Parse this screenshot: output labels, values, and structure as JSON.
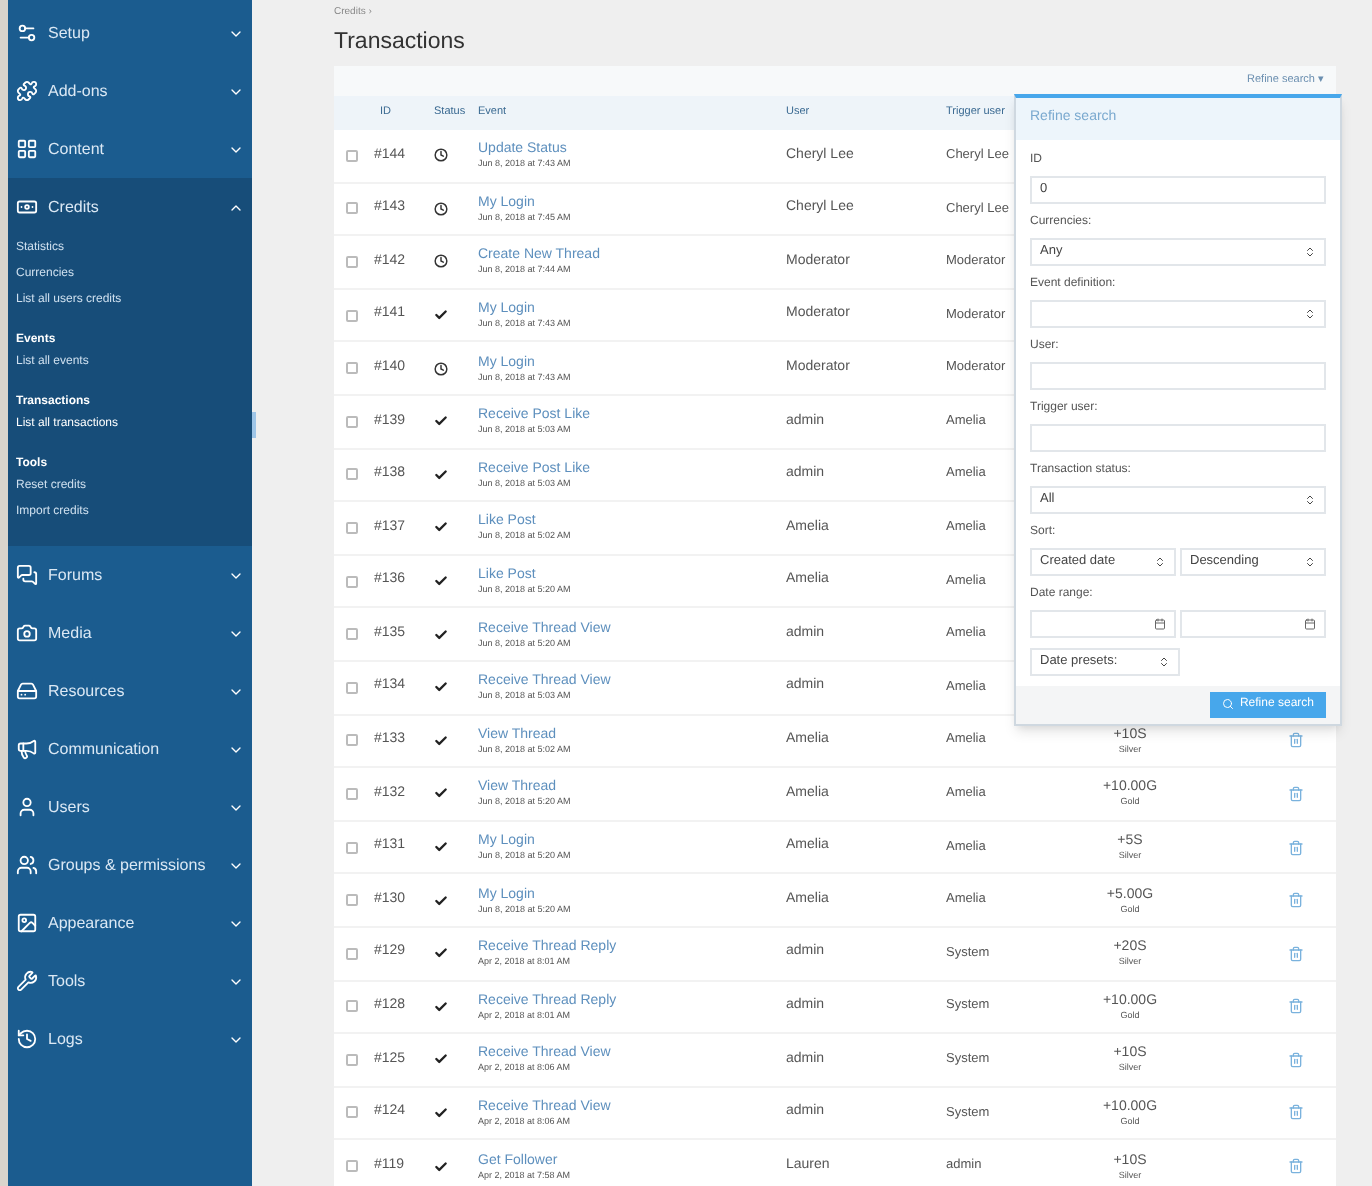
{
  "sidebar": {
    "items": [
      {
        "label": "Setup",
        "expanded": false
      },
      {
        "label": "Add-ons",
        "expanded": false
      },
      {
        "label": "Content",
        "expanded": false
      },
      {
        "label": "Credits",
        "expanded": true,
        "children": [
          {
            "kind": "link",
            "label": "Statistics",
            "selected": false
          },
          {
            "kind": "link",
            "label": "Currencies",
            "selected": false
          },
          {
            "kind": "link",
            "label": "List all users credits",
            "selected": false
          },
          {
            "kind": "heading",
            "label": "Events"
          },
          {
            "kind": "link",
            "label": "List all events",
            "selected": false
          },
          {
            "kind": "heading",
            "label": "Transactions"
          },
          {
            "kind": "link",
            "label": "List all transactions",
            "selected": true
          },
          {
            "kind": "heading",
            "label": "Tools"
          },
          {
            "kind": "link",
            "label": "Reset credits",
            "selected": false
          },
          {
            "kind": "link",
            "label": "Import credits",
            "selected": false
          }
        ]
      },
      {
        "label": "Forums",
        "expanded": false
      },
      {
        "label": "Media",
        "expanded": false
      },
      {
        "label": "Resources",
        "expanded": false
      },
      {
        "label": "Communication",
        "expanded": false
      },
      {
        "label": "Users",
        "expanded": false
      },
      {
        "label": "Groups & permissions",
        "expanded": false
      },
      {
        "label": "Appearance",
        "expanded": false
      },
      {
        "label": "Tools",
        "expanded": false
      },
      {
        "label": "Logs",
        "expanded": false
      }
    ]
  },
  "breadcrumb": "Credits ›",
  "title": "Transactions",
  "refine_toggle": "Refine search ▾",
  "table": {
    "columns": [
      "ID",
      "Status",
      "Event",
      "User",
      "Trigger user"
    ],
    "rows": [
      {
        "checked": false,
        "id": "#144",
        "kind": "pending",
        "event": "Update Status",
        "date": "Jun 8, 2018 at 7:43 AM",
        "user": "Cheryl Lee",
        "trigger": "Cheryl Lee"
      },
      {
        "checked": false,
        "id": "#143",
        "kind": "pending",
        "event": "My Login",
        "date": "Jun 8, 2018 at 7:45 AM",
        "user": "Cheryl Lee",
        "trigger": "Cheryl Lee"
      },
      {
        "checked": false,
        "id": "#142",
        "kind": "pending",
        "event": "Create New Thread",
        "date": "Jun 8, 2018 at 7:44 AM",
        "user": "Moderator",
        "trigger": "Moderator"
      },
      {
        "checked": false,
        "id": "#141",
        "kind": "completed",
        "event": "My Login",
        "date": "Jun 8, 2018 at 7:43 AM",
        "user": "Moderator",
        "trigger": "Moderator"
      },
      {
        "checked": false,
        "id": "#140",
        "kind": "pending",
        "event": "My Login",
        "date": "Jun 8, 2018 at 7:43 AM",
        "user": "Moderator",
        "trigger": "Moderator"
      },
      {
        "checked": false,
        "id": "#139",
        "kind": "completed",
        "event": "Receive Post Like",
        "date": "Jun 8, 2018 at 5:03 AM",
        "user": "admin",
        "trigger": "Amelia"
      },
      {
        "checked": false,
        "id": "#138",
        "kind": "completed",
        "event": "Receive Post Like",
        "date": "Jun 8, 2018 at 5:03 AM",
        "user": "admin",
        "trigger": "Amelia"
      },
      {
        "checked": false,
        "id": "#137",
        "kind": "completed",
        "event": "Like Post",
        "date": "Jun 8, 2018 at 5:02 AM",
        "user": "Amelia",
        "trigger": "Amelia"
      },
      {
        "checked": false,
        "id": "#136",
        "kind": "completed",
        "event": "Like Post",
        "date": "Jun 8, 2018 at 5:20 AM",
        "user": "Amelia",
        "trigger": "Amelia"
      },
      {
        "checked": false,
        "id": "#135",
        "kind": "completed",
        "event": "Receive Thread View",
        "date": "Jun 8, 2018 at 5:20 AM",
        "user": "admin",
        "trigger": "Amelia"
      },
      {
        "checked": false,
        "id": "#134",
        "kind": "completed",
        "event": "Receive Thread View",
        "date": "Jun 8, 2018 at 5:03 AM",
        "user": "admin",
        "trigger": "Amelia"
      },
      {
        "checked": false,
        "id": "#133",
        "kind": "completed",
        "event": "View Thread",
        "date": "Jun 8, 2018 at 5:02 AM",
        "user": "Amelia",
        "trigger": "Amelia",
        "amount": "+10S",
        "currency": "Silver"
      },
      {
        "checked": false,
        "id": "#132",
        "kind": "completed",
        "event": "View Thread",
        "date": "Jun 8, 2018 at 5:20 AM",
        "user": "Amelia",
        "trigger": "Amelia",
        "amount": "+10.00G",
        "currency": "Gold"
      },
      {
        "checked": false,
        "id": "#131",
        "kind": "completed",
        "event": "My Login",
        "date": "Jun 8, 2018 at 5:20 AM",
        "user": "Amelia",
        "trigger": "Amelia",
        "amount": "+5S",
        "currency": "Silver"
      },
      {
        "checked": false,
        "id": "#130",
        "kind": "completed",
        "event": "My Login",
        "date": "Jun 8, 2018 at 5:20 AM",
        "user": "Amelia",
        "trigger": "Amelia",
        "amount": "+5.00G",
        "currency": "Gold"
      },
      {
        "checked": false,
        "id": "#129",
        "kind": "completed",
        "event": "Receive Thread Reply",
        "date": "Apr 2, 2018 at 8:01 AM",
        "user": "admin",
        "trigger": "System",
        "amount": "+20S",
        "currency": "Silver"
      },
      {
        "checked": false,
        "id": "#128",
        "kind": "completed",
        "event": "Receive Thread Reply",
        "date": "Apr 2, 2018 at 8:01 AM",
        "user": "admin",
        "trigger": "System",
        "amount": "+10.00G",
        "currency": "Gold"
      },
      {
        "checked": false,
        "id": "#125",
        "kind": "completed",
        "event": "Receive Thread View",
        "date": "Apr 2, 2018 at 8:06 AM",
        "user": "admin",
        "trigger": "System",
        "amount": "+10S",
        "currency": "Silver"
      },
      {
        "checked": false,
        "id": "#124",
        "kind": "completed",
        "event": "Receive Thread View",
        "date": "Apr 2, 2018 at 8:06 AM",
        "user": "admin",
        "trigger": "System",
        "amount": "+10.00G",
        "currency": "Gold"
      },
      {
        "checked": false,
        "id": "#119",
        "kind": "completed",
        "event": "Get Follower",
        "date": "Apr 2, 2018 at 7:58 AM",
        "user": "Lauren",
        "trigger": "admin",
        "amount": "+10S",
        "currency": "Silver"
      }
    ]
  },
  "refine_panel": {
    "title": "Refine search",
    "fields": [
      {
        "kind": "input",
        "label": "ID",
        "value": "0"
      },
      {
        "kind": "select",
        "label": "Currencies:",
        "value": "Any"
      },
      {
        "kind": "select",
        "label": "Event definition:"
      },
      {
        "kind": "input",
        "label": "User:"
      },
      {
        "kind": "input",
        "label": "Trigger user:"
      },
      {
        "kind": "select",
        "label": "Transaction status:",
        "value": "All"
      },
      {
        "kind": "select_pair",
        "label": "Sort:",
        "values": [
          "Created date",
          "Descending"
        ]
      },
      {
        "kind": "date_pair",
        "label": "Date range:"
      },
      {
        "kind": "select_short",
        "value": "Date presets:"
      }
    ],
    "button": "Refine search"
  }
}
